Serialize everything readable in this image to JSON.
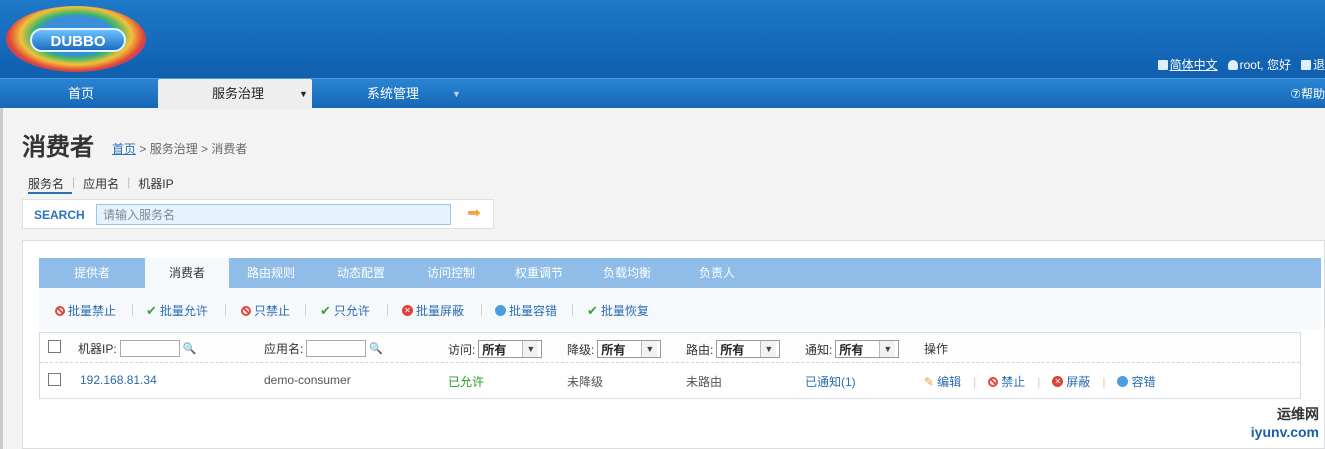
{
  "header": {
    "logo_text": "DUBBO",
    "lang_link": "简体中文",
    "user_greeting": "root, 您好",
    "exit_label": "退"
  },
  "nav": {
    "items": [
      "首页",
      "服务治理",
      "系统管理"
    ],
    "help": "帮助"
  },
  "page": {
    "title": "消费者",
    "breadcrumb_home": "首页",
    "breadcrumb_rest": " > 服务治理 > 消费者"
  },
  "filter_tabs": [
    "服务名",
    "应用名",
    "机器IP"
  ],
  "search": {
    "label": "SEARCH",
    "placeholder": "请输入服务名"
  },
  "tabs": [
    "提供者",
    "消费者",
    "路由规则",
    "动态配置",
    "访问控制",
    "权重调节",
    "负载均衡",
    "负责人"
  ],
  "toolbar": [
    "批量禁止",
    "批量允许",
    "只禁止",
    "只允许",
    "批量屏蔽",
    "批量容错",
    "批量恢复"
  ],
  "grid": {
    "headers": {
      "ip": "机器IP:",
      "app": "应用名:",
      "access": "访问:",
      "degrade": "降级:",
      "route": "路由:",
      "notify": "通知:",
      "ops": "操作"
    },
    "select_value": "所有",
    "row": {
      "ip": "192.168.81.34",
      "app": "demo-consumer",
      "access": "已允许",
      "degrade": "未降级",
      "route": "未路由",
      "notify": "已通知(1)",
      "ops": [
        "编辑",
        "禁止",
        "屏蔽",
        "容错"
      ]
    }
  },
  "watermark": {
    "line1": "运维网",
    "line2": "iyunv.com"
  },
  "colors": {
    "header": "#1668b6",
    "tab_bar": "#8fbde8",
    "link": "#2a6cb0",
    "allow": "#2a9a2a",
    "deny": "#e04a3a"
  }
}
